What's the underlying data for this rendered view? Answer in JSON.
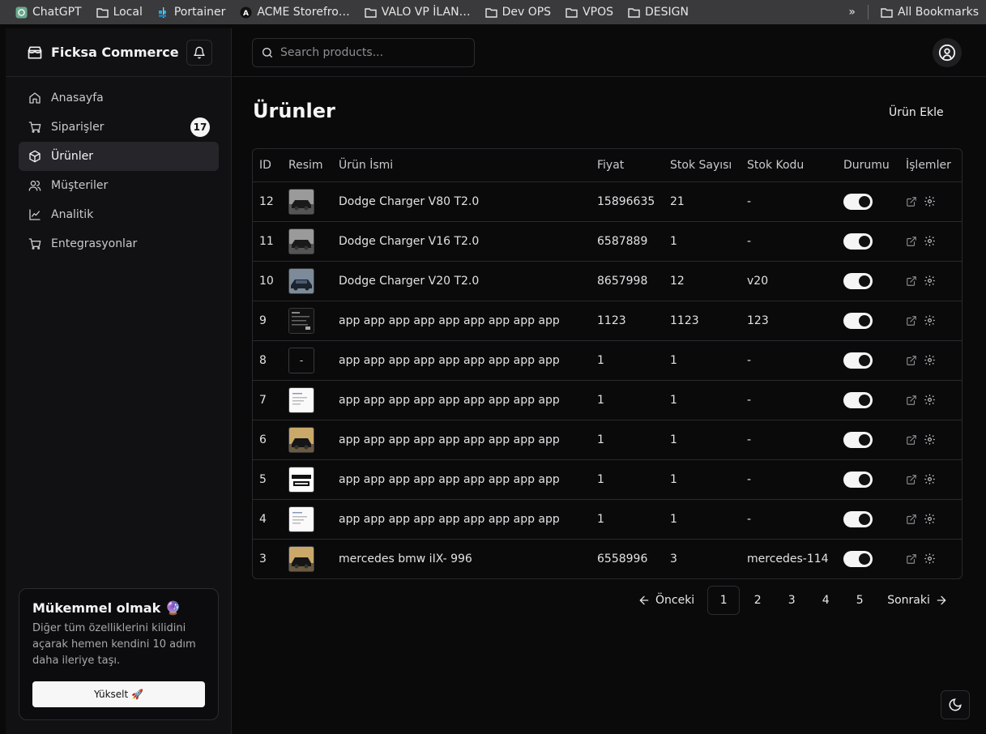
{
  "bookmarks": [
    {
      "label": "ChatGPT",
      "icon": "chatgpt-icon"
    },
    {
      "label": "Local",
      "icon": "folder-icon"
    },
    {
      "label": "Portainer",
      "icon": "portainer-icon"
    },
    {
      "label": "ACME Storefro…",
      "icon": "acme-icon"
    },
    {
      "label": "VALO VP İLAN…",
      "icon": "folder-icon"
    },
    {
      "label": "Dev OPS",
      "icon": "folder-icon"
    },
    {
      "label": "VPOS",
      "icon": "folder-icon"
    },
    {
      "label": "DESIGN",
      "icon": "folder-icon"
    }
  ],
  "bookmarks_more": "»",
  "bookmarks_all": "All Bookmarks",
  "brand": {
    "name": "Ficksa Commerce",
    "icon": "store-icon"
  },
  "nav": [
    {
      "label": "Anasayfa",
      "icon": "home-icon"
    },
    {
      "label": "Siparişler",
      "icon": "cart-icon",
      "badge": "17"
    },
    {
      "label": "Ürünler",
      "icon": "package-icon",
      "active": true
    },
    {
      "label": "Müşteriler",
      "icon": "users-icon"
    },
    {
      "label": "Analitik",
      "icon": "chart-icon"
    },
    {
      "label": "Entegrasyonlar",
      "icon": "cart-icon"
    }
  ],
  "promo": {
    "title": "Mükemmel olmak 🔮",
    "text": "Diğer tüm özelliklerini kilidini açarak hemen kendini 10 adım daha ileriye taşı.",
    "button": "Yükselt 🚀"
  },
  "search": {
    "placeholder": "Search products...",
    "value": ""
  },
  "page": {
    "title": "Ürünler",
    "add_button": "Ürün Ekle"
  },
  "table": {
    "headers": [
      "ID",
      "Resim",
      "Ürün İsmi",
      "Fiyat",
      "Stok Sayısı",
      "Stok Kodu",
      "Durumu",
      "İşlemler"
    ],
    "rows": [
      {
        "id": "12",
        "img": "car-dark",
        "name": "Dodge Charger V80 T2.0",
        "price": "15896635",
        "stock": "21",
        "code": "-",
        "active": true
      },
      {
        "id": "11",
        "img": "car-dark",
        "name": "Dodge Charger V16 T2.0",
        "price": "6587889",
        "stock": "1",
        "code": "-",
        "active": true
      },
      {
        "id": "10",
        "img": "car-blue",
        "name": "Dodge Charger V20 T2.0",
        "price": "8657998",
        "stock": "12",
        "code": "v20",
        "active": true
      },
      {
        "id": "9",
        "img": "screenshot",
        "name": "app app app app app app app app app",
        "price": "1123",
        "stock": "1123",
        "code": "123",
        "active": true
      },
      {
        "id": "8",
        "img": "empty",
        "img_text": "-",
        "name": "app app app app app app app app app",
        "price": "1",
        "stock": "1",
        "code": "-",
        "active": true
      },
      {
        "id": "7",
        "img": "document",
        "name": "app app app app app app app app app",
        "price": "1",
        "stock": "1",
        "code": "-",
        "active": true
      },
      {
        "id": "6",
        "img": "car-gold",
        "name": "app app app app app app app app app",
        "price": "1",
        "stock": "1",
        "code": "-",
        "active": true
      },
      {
        "id": "5",
        "img": "logo",
        "name": "app app app app app app app app app",
        "price": "1",
        "stock": "1",
        "code": "-",
        "active": true
      },
      {
        "id": "4",
        "img": "document",
        "name": "app app app app app app app app app",
        "price": "1",
        "stock": "1",
        "code": "-",
        "active": true
      },
      {
        "id": "3",
        "img": "car-gold",
        "name": "mercedes bmw iIX- 996",
        "price": "6558996",
        "stock": "3",
        "code": "mercedes-114",
        "active": true
      }
    ]
  },
  "pagination": {
    "prev": "Önceki",
    "next": "Sonraki",
    "pages": [
      "1",
      "2",
      "3",
      "4",
      "5"
    ],
    "current": "1"
  }
}
